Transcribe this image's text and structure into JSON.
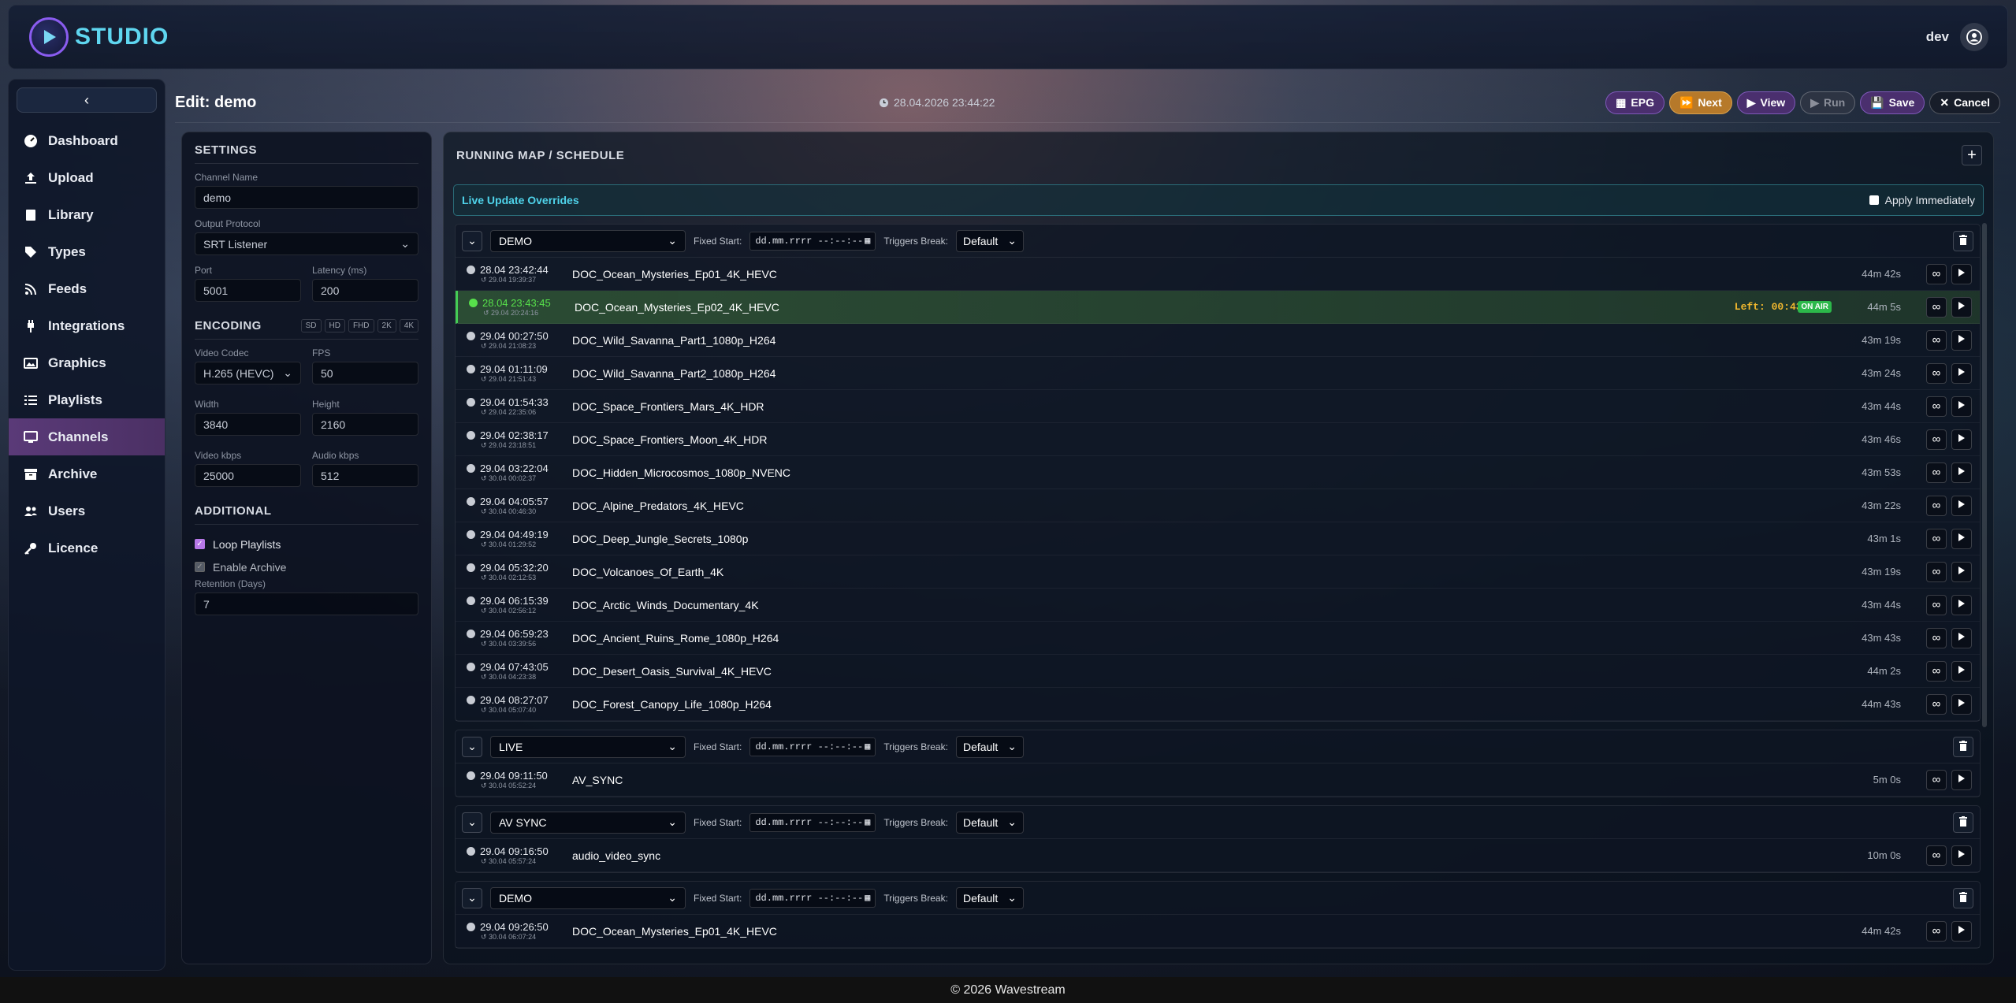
{
  "app": {
    "logo_text": "STUDIO",
    "user": "dev"
  },
  "sidebar": {
    "items": [
      {
        "label": "Dashboard",
        "icon": "dashboard-icon"
      },
      {
        "label": "Upload",
        "icon": "upload-icon"
      },
      {
        "label": "Library",
        "icon": "library-icon"
      },
      {
        "label": "Types",
        "icon": "tags-icon"
      },
      {
        "label": "Feeds",
        "icon": "feed-icon"
      },
      {
        "label": "Integrations",
        "icon": "plug-icon"
      },
      {
        "label": "Graphics",
        "icon": "image-icon"
      },
      {
        "label": "Playlists",
        "icon": "list-icon"
      },
      {
        "label": "Channels",
        "icon": "monitor-icon",
        "active": true
      },
      {
        "label": "Archive",
        "icon": "archive-icon"
      },
      {
        "label": "Users",
        "icon": "users-icon"
      },
      {
        "label": "Licence",
        "icon": "key-icon"
      }
    ]
  },
  "header": {
    "title": "Edit: demo",
    "datetime": "28.04.2026 23:44:22",
    "buttons": {
      "epg": "EPG",
      "next": "Next",
      "view": "View",
      "run": "Run",
      "save": "Save",
      "cancel": "Cancel"
    }
  },
  "settings": {
    "title": "SETTINGS",
    "channel_name_label": "Channel Name",
    "channel_name": "demo",
    "protocol_label": "Output Protocol",
    "protocol": "SRT Listener",
    "port_label": "Port",
    "port": "5001",
    "latency_label": "Latency (ms)",
    "latency": "200",
    "encoding_title": "ENCODING",
    "presets": [
      "SD",
      "HD",
      "FHD",
      "2K",
      "4K"
    ],
    "codec_label": "Video Codec",
    "codec": "H.265 (HEVC)",
    "fps_label": "FPS",
    "fps": "50",
    "width_label": "Width",
    "width": "3840",
    "height_label": "Height",
    "height": "2160",
    "vkbps_label": "Video kbps",
    "vkbps": "25000",
    "akbps_label": "Audio kbps",
    "akbps": "512",
    "additional_title": "ADDITIONAL",
    "loop_label": "Loop Playlists",
    "archive_label": "Enable Archive",
    "retention_label": "Retention (Days)",
    "retention": "7"
  },
  "schedule": {
    "title": "RUNNING MAP / SCHEDULE",
    "live_update": "Live Update Overrides",
    "apply_immediately": "Apply Immediately",
    "fixed_start_label": "Fixed Start:",
    "date_placeholder": "dd.mm.rrrr --:--:--",
    "triggers_label": "Triggers Break:",
    "triggers_value": "Default",
    "left_label": "Left: 00:43:28",
    "on_air": "ON AIR",
    "blocks": [
      {
        "name": "DEMO",
        "items": [
          {
            "time": "28.04 23:42:44",
            "sub": "29.04 19:39:37",
            "clip": "DOC_Ocean_Mysteries_Ep01_4K_HEVC",
            "dur": "44m 42s"
          },
          {
            "time": "28.04 23:43:45",
            "sub": "29.04 20:24:16",
            "clip": "DOC_Ocean_Mysteries_Ep02_4K_HEVC",
            "dur": "44m 5s",
            "onair": true
          },
          {
            "time": "29.04 00:27:50",
            "sub": "29.04 21:08:23",
            "clip": "DOC_Wild_Savanna_Part1_1080p_H264",
            "dur": "43m 19s"
          },
          {
            "time": "29.04 01:11:09",
            "sub": "29.04 21:51:43",
            "clip": "DOC_Wild_Savanna_Part2_1080p_H264",
            "dur": "43m 24s"
          },
          {
            "time": "29.04 01:54:33",
            "sub": "29.04 22:35:06",
            "clip": "DOC_Space_Frontiers_Mars_4K_HDR",
            "dur": "43m 44s"
          },
          {
            "time": "29.04 02:38:17",
            "sub": "29.04 23:18:51",
            "clip": "DOC_Space_Frontiers_Moon_4K_HDR",
            "dur": "43m 46s"
          },
          {
            "time": "29.04 03:22:04",
            "sub": "30.04 00:02:37",
            "clip": "DOC_Hidden_Microcosmos_1080p_NVENC",
            "dur": "43m 53s"
          },
          {
            "time": "29.04 04:05:57",
            "sub": "30.04 00:46:30",
            "clip": "DOC_Alpine_Predators_4K_HEVC",
            "dur": "43m 22s"
          },
          {
            "time": "29.04 04:49:19",
            "sub": "30.04 01:29:52",
            "clip": "DOC_Deep_Jungle_Secrets_1080p",
            "dur": "43m 1s"
          },
          {
            "time": "29.04 05:32:20",
            "sub": "30.04 02:12:53",
            "clip": "DOC_Volcanoes_Of_Earth_4K",
            "dur": "43m 19s"
          },
          {
            "time": "29.04 06:15:39",
            "sub": "30.04 02:56:12",
            "clip": "DOC_Arctic_Winds_Documentary_4K",
            "dur": "43m 44s"
          },
          {
            "time": "29.04 06:59:23",
            "sub": "30.04 03:39:56",
            "clip": "DOC_Ancient_Ruins_Rome_1080p_H264",
            "dur": "43m 43s"
          },
          {
            "time": "29.04 07:43:05",
            "sub": "30.04 04:23:38",
            "clip": "DOC_Desert_Oasis_Survival_4K_HEVC",
            "dur": "44m 2s"
          },
          {
            "time": "29.04 08:27:07",
            "sub": "30.04 05:07:40",
            "clip": "DOC_Forest_Canopy_Life_1080p_H264",
            "dur": "44m 43s"
          }
        ]
      },
      {
        "name": "LIVE",
        "items": [
          {
            "time": "29.04 09:11:50",
            "sub": "30.04 05:52:24",
            "clip": "AV_SYNC",
            "dur": "5m 0s"
          }
        ]
      },
      {
        "name": "AV SYNC",
        "items": [
          {
            "time": "29.04 09:16:50",
            "sub": "30.04 05:57:24",
            "clip": "audio_video_sync",
            "dur": "10m 0s"
          }
        ]
      },
      {
        "name": "DEMO",
        "items": [
          {
            "time": "29.04 09:26:50",
            "sub": "30.04 06:07:24",
            "clip": "DOC_Ocean_Mysteries_Ep01_4K_HEVC",
            "dur": "44m 42s"
          }
        ]
      }
    ]
  },
  "footer": "© 2026 Wavestream",
  "colors": {
    "accent": "#5fd6f0",
    "active_nav": "#5a3a78",
    "onair": "#2cb84a",
    "gold": "#b6792a"
  }
}
